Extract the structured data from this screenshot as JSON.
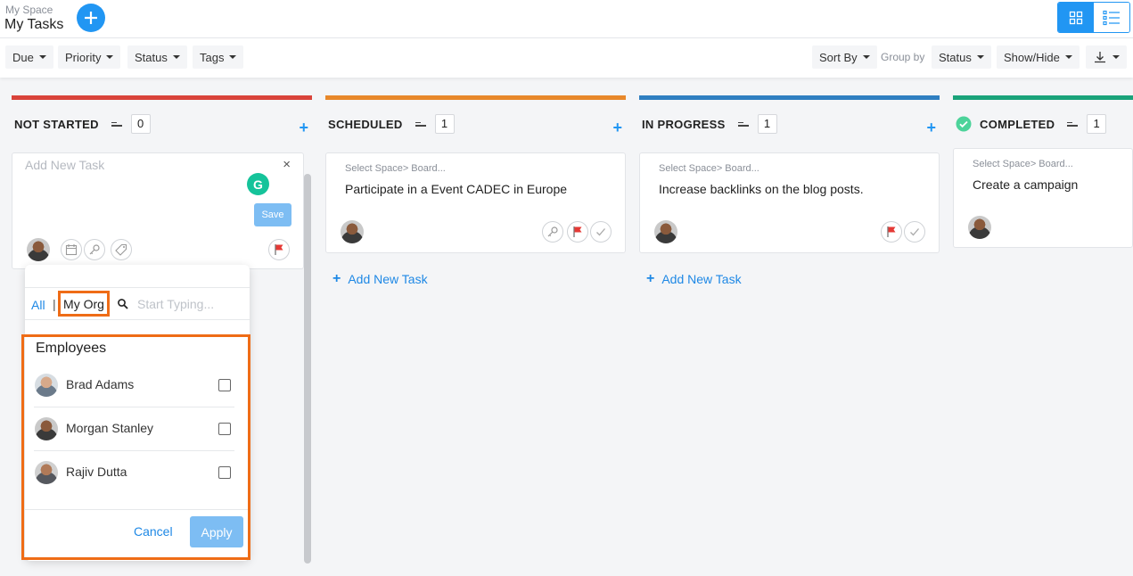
{
  "header": {
    "breadcrumb": "My Space",
    "title": "My Tasks",
    "add_icon": "plus-icon",
    "views": [
      "board-view-icon",
      "list-view-icon"
    ]
  },
  "filters": {
    "due": "Due",
    "priority": "Priority",
    "status": "Status",
    "tags": "Tags",
    "sort_by": "Sort By",
    "group_by_label": "Group by",
    "group_by_value": "Status",
    "show_hide": "Show/Hide"
  },
  "colors": {
    "accent": "#2196f3",
    "not_started": "#d9433a",
    "scheduled": "#e8882a",
    "in_progress": "#2f7fc1",
    "completed": "#1aa37a",
    "highlight": "#ef6c16"
  },
  "columns": [
    {
      "title": "NOT STARTED",
      "count": "0",
      "add_task": "Add New Task"
    },
    {
      "title": "SCHEDULED",
      "count": "1",
      "add_task": "Add New Task",
      "card": {
        "space": "Select Space> Board...",
        "title": "Participate in a Event CADEC in Europe"
      }
    },
    {
      "title": "IN PROGRESS",
      "count": "1",
      "add_task": "Add New Task",
      "card": {
        "space": "Select Space> Board...",
        "title": "Increase backlinks on the blog posts."
      }
    },
    {
      "title": "COMPLETED",
      "count": "1",
      "card": {
        "space": "Select Space> Board...",
        "title": "Create a campaign"
      }
    }
  ],
  "editor": {
    "placeholder": "Add New Task",
    "close": "×",
    "grammarly": "G",
    "save": "Save"
  },
  "assignee_dropdown": {
    "tab_all": "All",
    "tab_separator": "|",
    "tab_my_org": "My Org",
    "search_placeholder": "Start Typing...",
    "heading": "Employees",
    "employees": [
      {
        "name": "Brad Adams"
      },
      {
        "name": "Morgan Stanley"
      },
      {
        "name": "Rajiv Dutta"
      }
    ],
    "cancel": "Cancel",
    "apply": "Apply"
  }
}
